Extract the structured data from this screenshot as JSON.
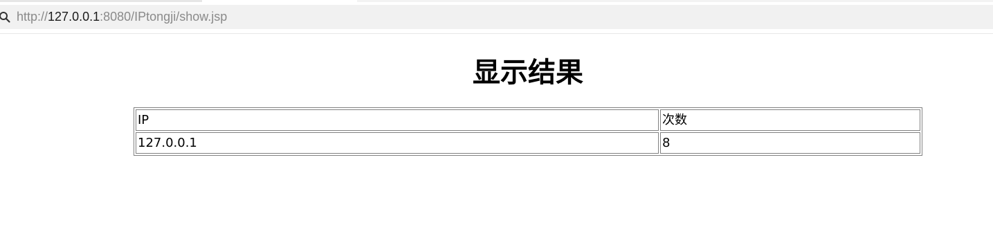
{
  "browser": {
    "url_prefix": "http://",
    "url_host": "127.0.0.1",
    "url_rest": ":8080/IPtongji/show.jsp",
    "search_icon": "search-icon"
  },
  "page": {
    "title": "显示结果"
  },
  "table": {
    "headers": [
      "IP",
      "次数"
    ],
    "rows": [
      [
        "127.0.0.1",
        "8"
      ]
    ]
  }
}
